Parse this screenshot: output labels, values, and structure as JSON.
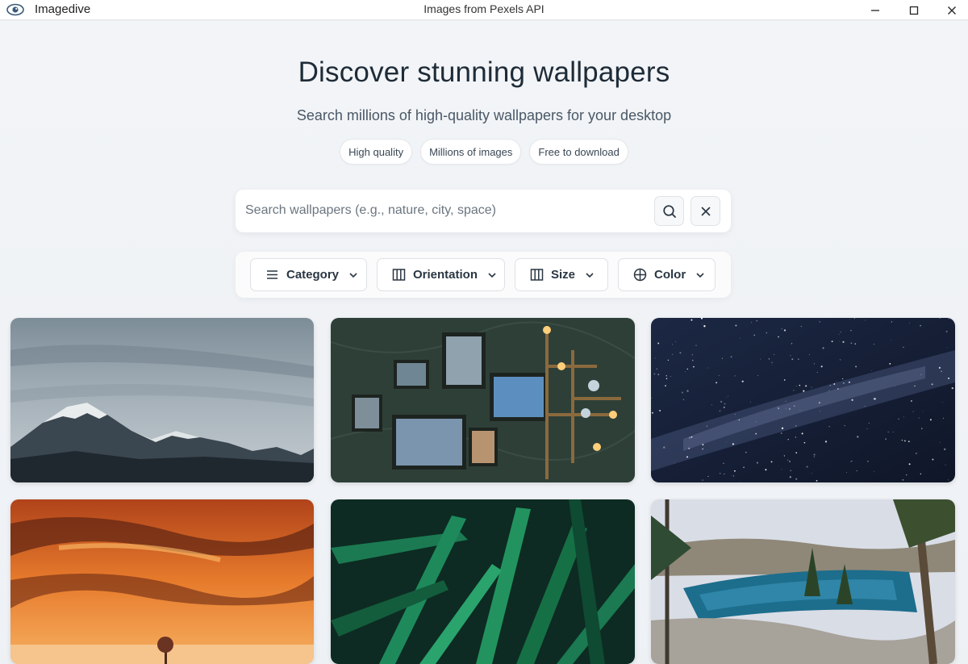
{
  "titlebar": {
    "app_name": "Imagedive",
    "window_title": "Images from Pexels API",
    "logo_icon": "eye-icon",
    "controls": [
      "minimize-icon",
      "maximize-icon",
      "close-icon"
    ]
  },
  "hero": {
    "title": "Discover stunning wallpapers",
    "subtitle": "Search millions of high-quality wallpapers for your desktop",
    "chips": [
      "High quality",
      "Millions of images",
      "Free to download"
    ]
  },
  "search": {
    "placeholder": "Search wallpapers (e.g., nature, city, space)",
    "value": "",
    "search_icon": "search-icon",
    "clear_icon": "close-icon"
  },
  "filters": [
    {
      "label": "Category",
      "icon": "list-icon"
    },
    {
      "label": "Orientation",
      "icon": "columns-icon"
    },
    {
      "label": "Size",
      "icon": "columns-icon"
    },
    {
      "label": "Color",
      "icon": "globe-icon"
    }
  ],
  "gallery": {
    "images": [
      {
        "subject": "snowy mountain range under cloudy sky"
      },
      {
        "subject": "framed photos with industrial pipe lamps on green wall"
      },
      {
        "subject": "starry night sky with milky way"
      },
      {
        "subject": "orange sunset clouds over lone tree"
      },
      {
        "subject": "green leaves with water droplets"
      },
      {
        "subject": "lake with pine trees and rocks"
      }
    ]
  },
  "colors": {
    "background": "#eef1f5",
    "text_primary": "#1e2b38",
    "text_secondary": "#4a5866",
    "card": "#ffffff"
  }
}
